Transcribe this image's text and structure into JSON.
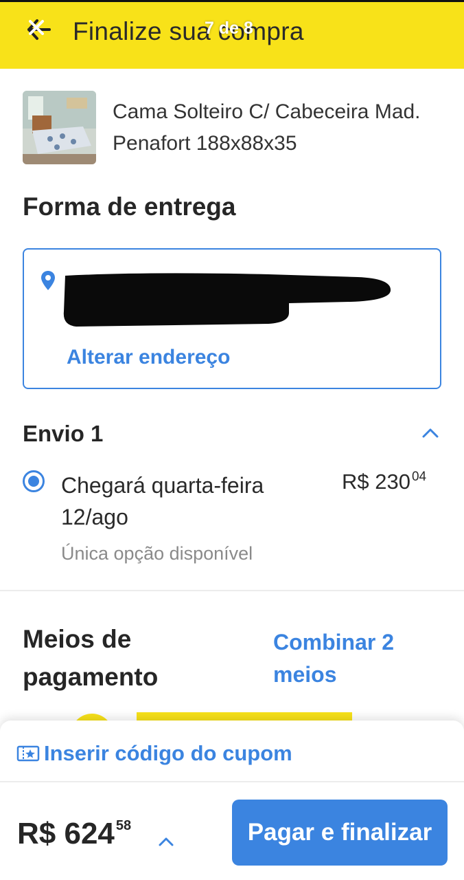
{
  "header": {
    "title": "Finalize sua compra",
    "story_counter": "7 de 8",
    "back_icon": "back-arrow-icon",
    "background_color": "#f8e219"
  },
  "product": {
    "title": "Cama Solteiro C/ Cabeceira Mad. Penafort 188x88x35",
    "image_icon": "bed-product-image"
  },
  "delivery": {
    "section_title": "Forma de entrega",
    "pin_icon": "location-pin-icon",
    "address_redacted": true,
    "change_address_label": "Alterar endereço"
  },
  "shipment": {
    "title": "Envio 1",
    "option_label": "Chegará quarta-feira 12/ago",
    "price_main": "R$ 230",
    "price_cents": "04",
    "note": "Única opção disponível",
    "selected": true
  },
  "payment": {
    "section_title": "Meios de pagamento",
    "combine_label": "Combinar 2 meios"
  },
  "footer": {
    "coupon_label": "Inserir código do cupom",
    "coupon_icon": "ticket-icon",
    "total_main": "R$ 624",
    "total_cents": "58",
    "pay_button_label": "Pagar e finalizar",
    "accent_color": "#3b84e0"
  }
}
